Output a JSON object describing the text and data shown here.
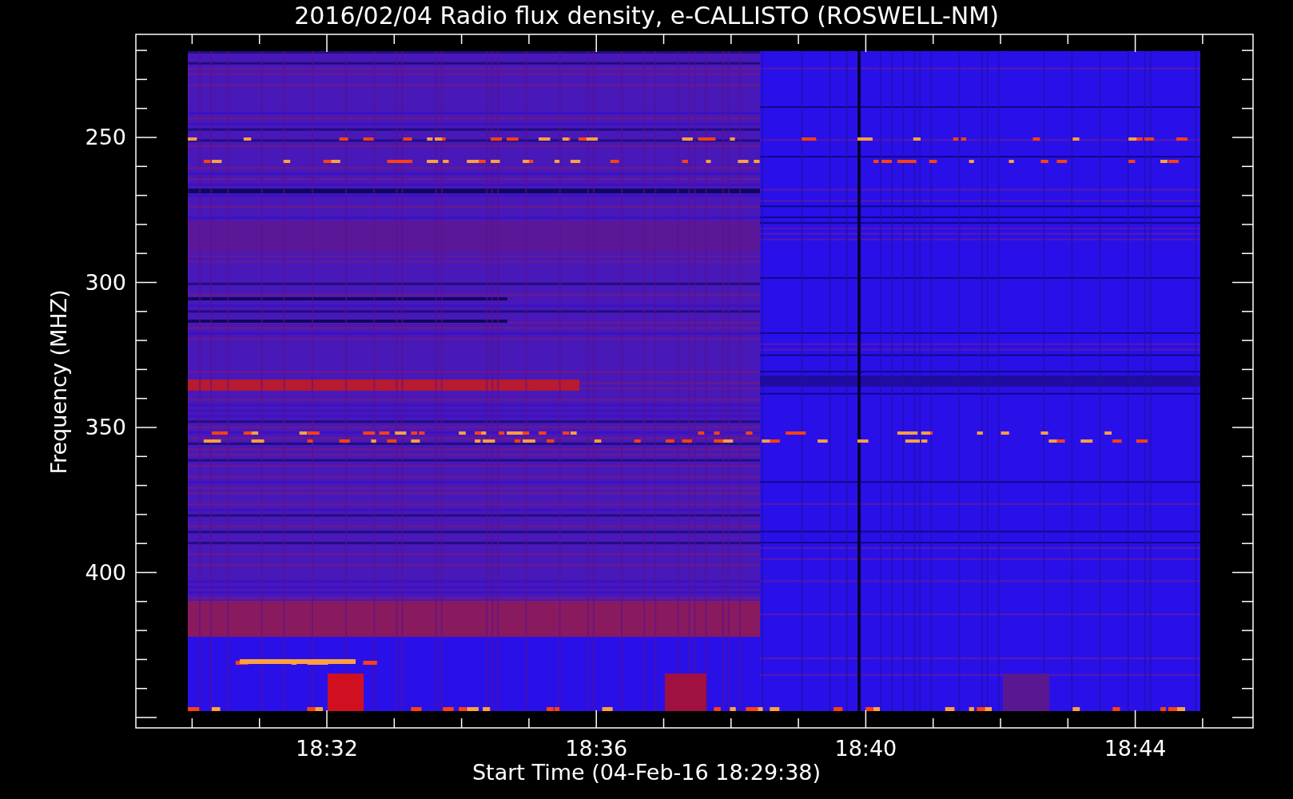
{
  "title": "2016/02/04  Radio flux density, e-CALLISTO (ROSWELL-NM)",
  "y_axis": {
    "label": "Frequency (MHZ)",
    "ticks": [
      "250",
      "300",
      "350",
      "400"
    ]
  },
  "x_axis": {
    "label": "Start Time (04-Feb-16 18:29:38)",
    "ticks": [
      "18:32",
      "18:36",
      "18:40",
      "18:44"
    ]
  }
}
